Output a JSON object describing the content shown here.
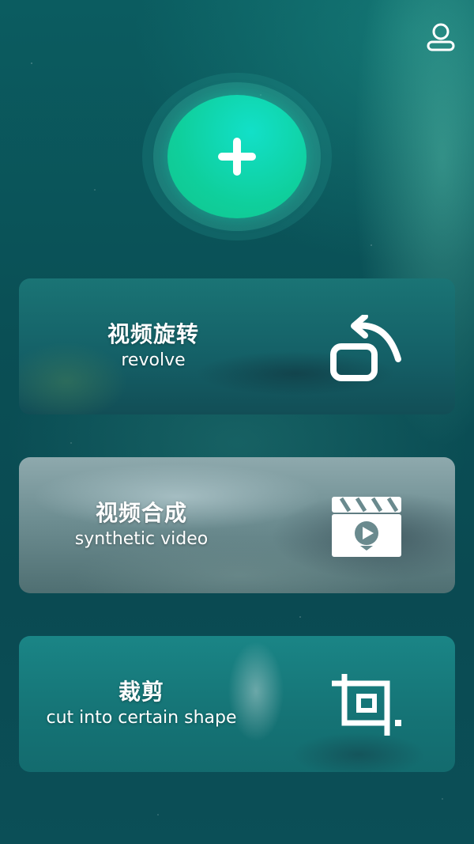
{
  "header": {
    "profile_icon": "user-profile-icon"
  },
  "add_button": {
    "icon": "plus-icon",
    "accent": "#12d6a8"
  },
  "cards": [
    {
      "title": "视频旋转",
      "subtitle": "revolve",
      "icon": "rotate-icon"
    },
    {
      "title": "视频合成",
      "subtitle": "synthetic video",
      "icon": "video-clapper-icon"
    },
    {
      "title": "裁剪",
      "subtitle": "cut into certain shape",
      "icon": "crop-icon"
    }
  ],
  "colors": {
    "background": "#0a4f55",
    "text": "#ffffff"
  }
}
